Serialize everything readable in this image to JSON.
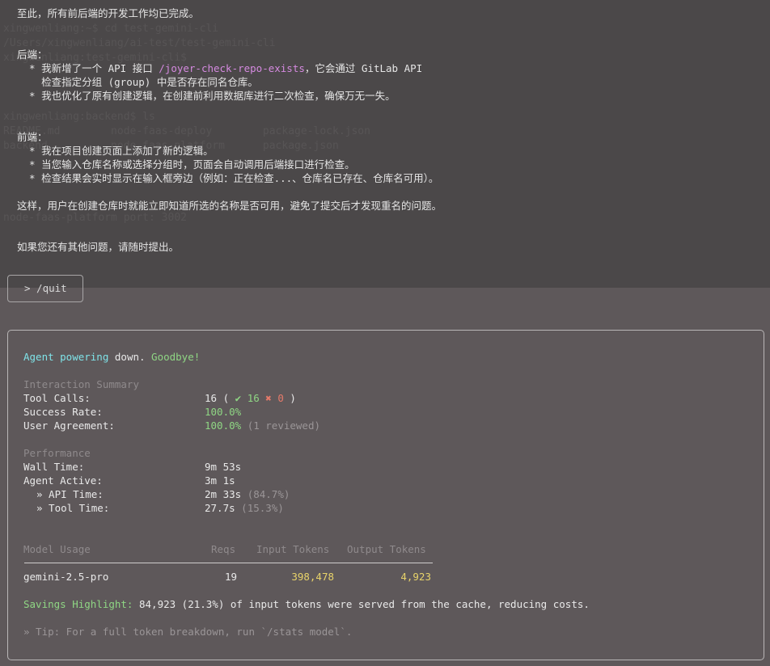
{
  "chat": {
    "intro": "至此，所有前后端的开发工作均已完成。",
    "backend_title": "后端：",
    "backend_1_pre": "  * 我新增了一个 API 接口 ",
    "backend_1_path": "/joyer-check-repo-exists",
    "backend_1_post": "，它会通过 GitLab API",
    "backend_1_cont": "    检查指定分组 (group) 中是否存在同名仓库。",
    "backend_2": "  * 我也优化了原有创建逻辑，在创建前利用数据库进行二次检查，确保万无一失。",
    "frontend_title": "前端：",
    "frontend_1": "  * 我在项目创建页面上添加了新的逻辑。",
    "frontend_2": "  * 当您输入仓库名称或选择分组时，页面会自动调用后端接口进行检查。",
    "frontend_3": "  * 检查结果会实时显示在输入框旁边（例如：正在检查...、仓库名已存在、仓库名可用）。",
    "summary": "这样，用户在创建仓库时就能立即知道所选的名称是否可用，避免了提交后才发现重名的问题。",
    "closing": "如果您还有其他问题，请随时提出。"
  },
  "prompt": {
    "command": "> /quit"
  },
  "stats": {
    "goodbye_a": "Agent powering ",
    "goodbye_b": "down. ",
    "goodbye_c": "Goodbye!",
    "interaction_header": "Interaction Summary",
    "tool_calls_label": "Tool Calls:",
    "tool_calls_value": "16",
    "tool_calls_success": "✔ 16",
    "tool_calls_fail": "✖ 0",
    "success_rate_label": "Success Rate:",
    "success_rate_value": "100.0%",
    "agreement_label": "User Agreement:",
    "agreement_value": "100.0%",
    "agreement_note": "(1 reviewed)",
    "performance_header": "Performance",
    "wall_time_label": "Wall Time:",
    "wall_time_value": "9m 53s",
    "agent_active_label": "Agent Active:",
    "agent_active_value": "3m 1s",
    "api_time_label": "» API Time:",
    "api_time_value": "2m 33s",
    "api_time_pct": "(84.7%)",
    "tool_time_label": "» Tool Time:",
    "tool_time_value": "27.7s",
    "tool_time_pct": "(15.3%)",
    "model_usage": {
      "headers": [
        "Model Usage",
        "Reqs",
        "Input Tokens",
        "Output Tokens"
      ],
      "model": "gemini-2.5-pro",
      "reqs": "19",
      "input_tokens": "398,478",
      "output_tokens": "4,923"
    },
    "savings_label": "Savings Highlight:",
    "savings_text": " 84,923 (21.3%) of input tokens were served from the cache, reducing costs.",
    "tip": "» Tip: For a full token breakdown, run `/stats model`."
  },
  "background_ghost": [
    "xingwenliang:~$ cd test-gemini-cli",
    "/Users/xingwenliang/ai-test/test-gemini-cli",
    "xingwenliang:test-gemini-cli$",
    "xingwenliang:backend$ ls",
    "README.md        node-faas-deploy        package-lock.json",
    "backend          node-faas-platform      package.json",
    "node-faas-platform port: 3002"
  ],
  "colors": {
    "accent_cyan": "#7fe3e8",
    "success_green": "#8fd684",
    "token_yellow": "#e8d36a",
    "fail_red": "#e67a6a",
    "path_pink": "#d58ae0"
  }
}
